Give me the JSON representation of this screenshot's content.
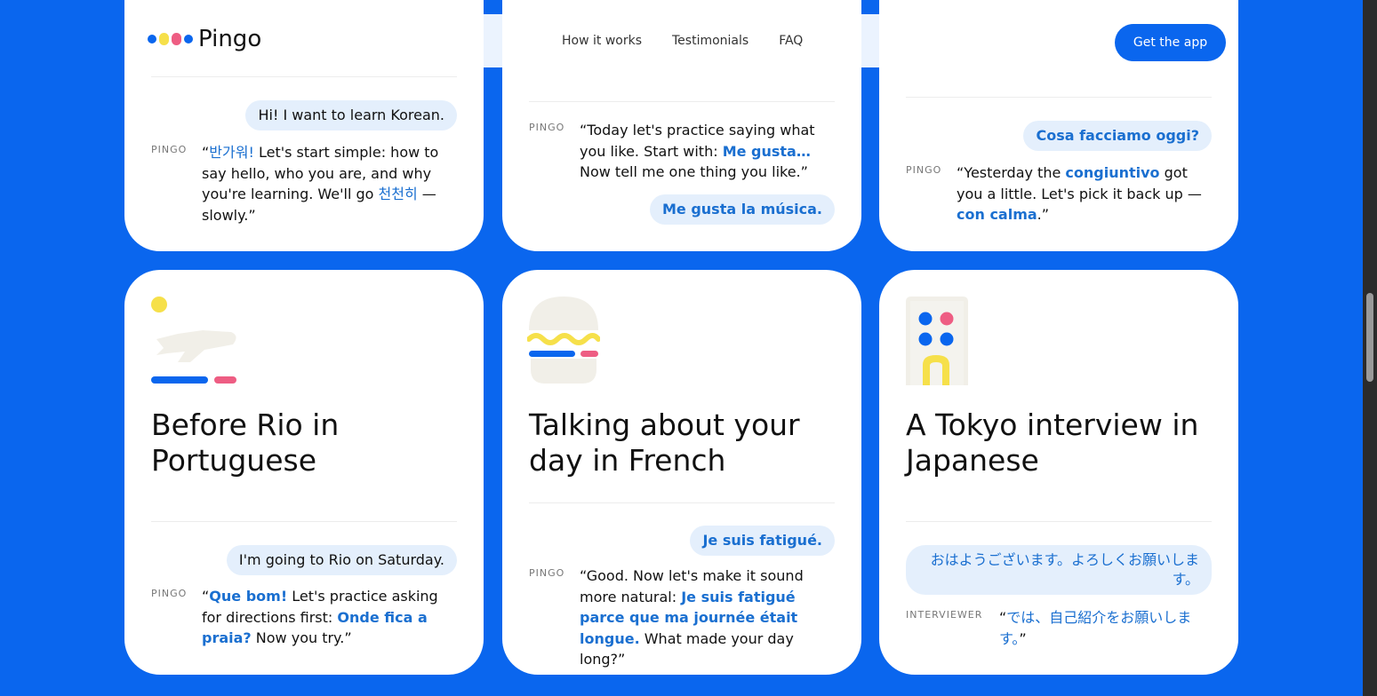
{
  "brand": {
    "name": "Pingo",
    "colors": {
      "primary": "#0a66ee",
      "yellow": "#f6e04a",
      "pink": "#ee5d83",
      "highlight": "#1a6fd0"
    }
  },
  "nav": {
    "items": [
      "How it works",
      "Testimonials",
      "FAQ"
    ],
    "cta": "Get the app"
  },
  "cards_top": [
    {
      "user": "Hi! I want to learn Korean.",
      "label": "PINGO",
      "reply": {
        "hl": "반가워!",
        "a": " Let's start simple: how to say hello, who you are, and why you're learning. We'll go ",
        "hl2": "천천히",
        "b": " — slowly.",
        "open": "“",
        "close": "”"
      }
    },
    {
      "label": "PINGO",
      "reply": {
        "a": "Today let's practice saying what you like. Start with: ",
        "hl": "Me gusta…",
        "b": " Now tell me one thing you like.",
        "open": "“",
        "close": "”"
      },
      "user": "Me gusta la música."
    },
    {
      "user": "Cosa facciamo oggi?",
      "label": "PINGO",
      "reply": {
        "a": "Yesterday the ",
        "hl": "congiuntivo",
        "b": " got you a little. Let's pick it back up — ",
        "hl2": "con calma",
        "c": ".",
        "open": "“",
        "close": "”"
      }
    }
  ],
  "cards_bottom": [
    {
      "title": "Before Rio in Portuguese",
      "icon": "airplane-icon",
      "user": "I'm going to Rio on Saturday.",
      "label": "PINGO",
      "reply": {
        "hl": "Que bom!",
        "a": " Let's practice asking for directions first: ",
        "hl2": "Onde fica a praia?",
        "b": " Now you try.",
        "open": "“",
        "close": "”"
      }
    },
    {
      "title": "Talking about your day in French",
      "icon": "burger-icon",
      "user": "Je suis fatigué.",
      "label": "PINGO",
      "reply": {
        "a": "Good. Now let's make it sound more natural: ",
        "hl": "Je suis fatigué parce que ma journée était longue.",
        "b": " What made your day long?",
        "open": "“",
        "close": "”"
      }
    },
    {
      "title": "A Tokyo interview in Japanese",
      "icon": "building-icon",
      "user": "おはようございます。よろしくお願いします。",
      "label": "INTERVIEWER",
      "reply": {
        "hl": "では、自己紹介をお願いします。",
        "open": "“",
        "close": "”"
      }
    }
  ]
}
